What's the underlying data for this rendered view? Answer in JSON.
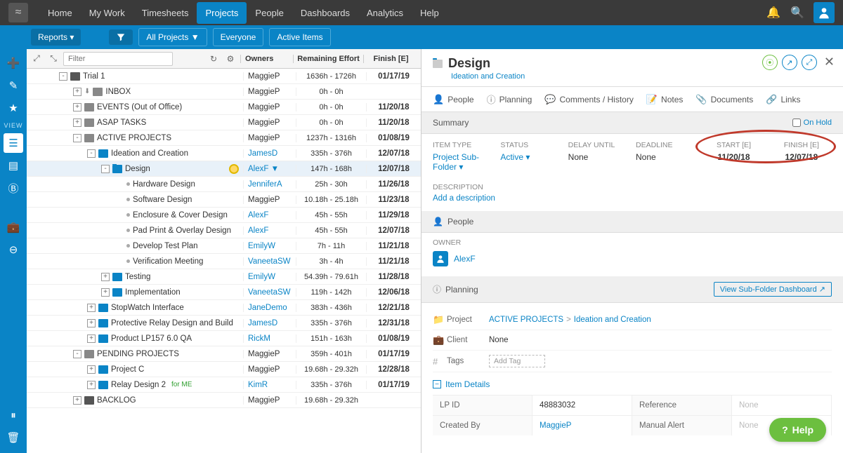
{
  "topnav": {
    "items": [
      "Home",
      "My Work",
      "Timesheets",
      "Projects",
      "People",
      "Dashboards",
      "Analytics",
      "Help"
    ],
    "active_index": 3
  },
  "subnav": {
    "reports": "Reports ▾",
    "filter1": "All Projects ▼",
    "filter2": "Everyone",
    "filter3": "Active Items"
  },
  "left_toolbar": {
    "filter_placeholder": "Filter"
  },
  "columns": {
    "owners": "Owners",
    "effort": "Remaining Effort",
    "finish": "Finish [E]"
  },
  "tree": [
    {
      "indent": 0,
      "toggle": "-",
      "icon": "package",
      "name": "Trial 1",
      "owner": "MaggieP",
      "owner_link": false,
      "effort": "1636h - 1726h",
      "finish": "01/17/19"
    },
    {
      "indent": 1,
      "toggle": "+",
      "dl": true,
      "icon": "box",
      "name": "INBOX",
      "owner": "MaggieP",
      "owner_link": false,
      "effort": "0h - 0h",
      "finish": ""
    },
    {
      "indent": 1,
      "toggle": "+",
      "icon": "box",
      "name": "EVENTS (Out of Office)",
      "owner": "MaggieP",
      "owner_link": false,
      "effort": "0h - 0h",
      "finish": "11/20/18"
    },
    {
      "indent": 1,
      "toggle": "+",
      "icon": "box",
      "name": "ASAP TASKS",
      "owner": "MaggieP",
      "owner_link": false,
      "effort": "0h - 0h",
      "finish": "11/20/18"
    },
    {
      "indent": 1,
      "toggle": "-",
      "icon": "box",
      "name": "ACTIVE PROJECTS",
      "owner": "MaggieP",
      "owner_link": false,
      "effort": "1237h - 1316h",
      "finish": "01/08/19"
    },
    {
      "indent": 2,
      "toggle": "-",
      "icon": "folder",
      "name": "Ideation and Creation",
      "owner": "JamesD",
      "owner_link": true,
      "effort": "335h - 376h",
      "finish": "12/07/18"
    },
    {
      "indent": 3,
      "toggle": "-",
      "icon": "folder",
      "name": "Design",
      "owner": "AlexF",
      "owner_link": true,
      "owner_caret": true,
      "effort": "147h - 168h",
      "finish": "12/07/18",
      "selected": true,
      "status": true
    },
    {
      "indent": 4,
      "toggle": "",
      "icon": "dot",
      "name": "Hardware Design",
      "owner": "JenniferA",
      "owner_link": true,
      "effort": "25h - 30h",
      "finish": "11/26/18"
    },
    {
      "indent": 4,
      "toggle": "",
      "icon": "dot",
      "name": "Software Design",
      "owner": "MaggieP",
      "owner_link": false,
      "effort": "10.18h - 25.18h",
      "finish": "11/23/18"
    },
    {
      "indent": 4,
      "toggle": "",
      "icon": "dot",
      "name": "Enclosure & Cover Design",
      "owner": "AlexF",
      "owner_link": true,
      "effort": "45h - 55h",
      "finish": "11/29/18"
    },
    {
      "indent": 4,
      "toggle": "",
      "icon": "dot",
      "name": "Pad Print & Overlay Design",
      "owner": "AlexF",
      "owner_link": true,
      "effort": "45h - 55h",
      "finish": "12/07/18"
    },
    {
      "indent": 4,
      "toggle": "",
      "icon": "dot",
      "name": "Develop Test Plan",
      "owner": "EmilyW",
      "owner_link": true,
      "effort": "7h - 11h",
      "finish": "11/21/18"
    },
    {
      "indent": 4,
      "toggle": "",
      "icon": "dot",
      "name": "Verification Meeting",
      "owner": "VaneetaSW",
      "owner_link": true,
      "effort": "3h - 4h",
      "finish": "11/21/18"
    },
    {
      "indent": 3,
      "toggle": "+",
      "icon": "folder",
      "name": "Testing",
      "owner": "EmilyW",
      "owner_link": true,
      "effort": "54.39h - 79.61h",
      "finish": "11/28/18"
    },
    {
      "indent": 3,
      "toggle": "+",
      "icon": "folder",
      "name": "Implementation",
      "owner": "VaneetaSW",
      "owner_link": true,
      "effort": "119h - 142h",
      "finish": "12/06/18"
    },
    {
      "indent": 2,
      "toggle": "+",
      "icon": "folder",
      "name": "StopWatch Interface",
      "owner": "JaneDemo",
      "owner_link": true,
      "effort": "383h - 436h",
      "finish": "12/21/18"
    },
    {
      "indent": 2,
      "toggle": "+",
      "icon": "folder",
      "name": "Protective Relay Design and Build",
      "owner": "JamesD",
      "owner_link": true,
      "effort": "335h - 376h",
      "finish": "12/31/18"
    },
    {
      "indent": 2,
      "toggle": "+",
      "icon": "folder",
      "name": "Product LP157 6.0 QA",
      "owner": "RickM",
      "owner_link": true,
      "effort": "151h - 163h",
      "finish": "01/08/19"
    },
    {
      "indent": 1,
      "toggle": "-",
      "icon": "box",
      "name": "PENDING PROJECTS",
      "owner": "MaggieP",
      "owner_link": false,
      "effort": "359h - 401h",
      "finish": "01/17/19"
    },
    {
      "indent": 2,
      "toggle": "+",
      "icon": "folder",
      "name": "Project C",
      "owner": "MaggieP",
      "owner_link": false,
      "effort": "19.68h - 29.32h",
      "finish": "12/28/18"
    },
    {
      "indent": 2,
      "toggle": "+",
      "icon": "folder",
      "name": "Relay Design 2",
      "suffix": "for ME",
      "owner": "KimR",
      "owner_link": true,
      "effort": "335h - 376h",
      "finish": "01/17/19"
    },
    {
      "indent": 1,
      "toggle": "+",
      "icon": "package",
      "name": "BACKLOG",
      "owner": "MaggieP",
      "owner_link": false,
      "effort": "19.68h - 29.32h",
      "finish": ""
    }
  ],
  "detail": {
    "title": "Design",
    "breadcrumb": "Ideation and Creation",
    "tabs": [
      "People",
      "Planning",
      "Comments / History",
      "Notes",
      "Documents",
      "Links"
    ],
    "summary_label": "Summary",
    "onhold_label": "On Hold",
    "cols": {
      "item_type": {
        "label": "ITEM TYPE",
        "value": "Project Sub-Folder ▾"
      },
      "status": {
        "label": "STATUS",
        "value": "Active ▾"
      },
      "delay": {
        "label": "DELAY UNTIL",
        "value": "None"
      },
      "deadline": {
        "label": "DEADLINE",
        "value": "None"
      },
      "start": {
        "label": "START [E]",
        "value": "11/20/18"
      },
      "finish": {
        "label": "FINISH [E]",
        "value": "12/07/18"
      }
    },
    "description_label": "DESCRIPTION",
    "add_description": "Add a description",
    "people_label": "People",
    "owner_label": "OWNER",
    "owner_name": "AlexF",
    "planning_label": "Planning",
    "view_dashboard": "View Sub-Folder Dashboard ↗",
    "project_label": "Project",
    "project_path1": "ACTIVE PROJECTS",
    "project_path2": "Ideation and Creation",
    "client_label": "Client",
    "client_value": "None",
    "tags_label": "Tags",
    "tags_placeholder": "Add Tag",
    "item_details": "Item Details",
    "lpid_label": "LP ID",
    "lpid_value": "48883032",
    "reference_label": "Reference",
    "reference_value": "None",
    "createdby_label": "Created By",
    "createdby_value": "MaggieP",
    "manual_alert_label": "Manual Alert",
    "manual_alert_value": "None"
  },
  "help": "Help"
}
